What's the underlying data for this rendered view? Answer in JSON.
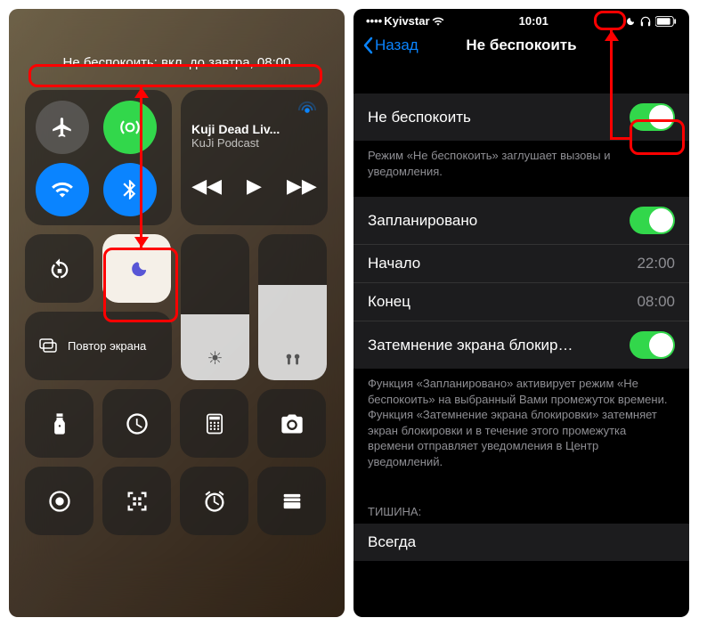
{
  "left": {
    "dnd_status": "Не беспокоить: вкл. до завтра, 08:00",
    "media_title": "Kuji Dead Liv...",
    "media_subtitle": "KuJi Podcast",
    "mirror_label": "Повтор экрана"
  },
  "right": {
    "carrier": "Kyivstar",
    "time": "10:01",
    "back_label": "Назад",
    "title": "Не беспокоить",
    "main_toggle_label": "Не беспокоить",
    "main_footer": "Режим «Не беспокоить» заглушает вызовы и уведомления.",
    "scheduled_label": "Запланировано",
    "start_label": "Начало",
    "start_value": "22:00",
    "end_label": "Конец",
    "end_value": "08:00",
    "dim_label": "Затемнение экрана блокир…",
    "scheduled_footer": "Функция «Запланировано» активирует режим «Не беспокоить» на выбранный Вами промежуток времени. Функция «Затемнение экрана блокировки» затемняет экран блокировки и в течение этого промежутка времени отправляет уведомления в Центр уведомлений.",
    "silence_header": "ТИШИНА:",
    "always_label": "Всегда"
  }
}
